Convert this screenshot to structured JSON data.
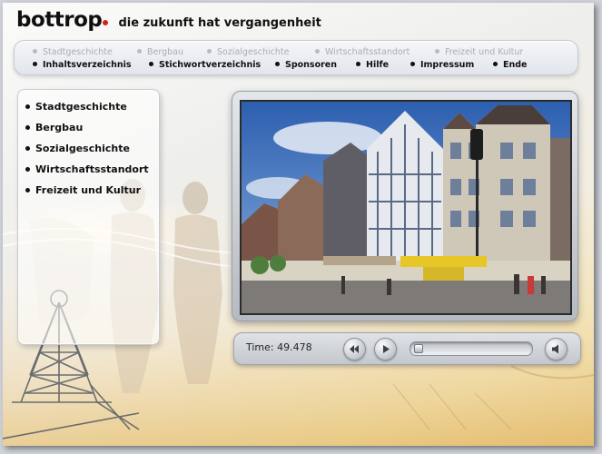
{
  "brand": {
    "name": "bottrop",
    "tagline": "die zukunft hat vergangenheit",
    "accent": "#d81e1e"
  },
  "topnav": {
    "chapters": [
      {
        "label": "Stadtgeschichte"
      },
      {
        "label": "Bergbau"
      },
      {
        "label": "Sozialgeschichte"
      },
      {
        "label": "Wirtschaftsstandort"
      },
      {
        "label": "Freizeit und Kultur"
      }
    ],
    "links": [
      {
        "label": "Inhaltsverzeichnis"
      },
      {
        "label": "Stichwortverzeichnis"
      },
      {
        "label": "Sponsoren"
      },
      {
        "label": "Hilfe"
      },
      {
        "label": "Impressum"
      },
      {
        "label": "Ende"
      }
    ]
  },
  "sidebar": {
    "items": [
      {
        "label": "Stadtgeschichte"
      },
      {
        "label": "Bergbau"
      },
      {
        "label": "Sozialgeschichte"
      },
      {
        "label": "Wirtschaftsstandort"
      },
      {
        "label": "Freizeit und Kultur"
      }
    ]
  },
  "player": {
    "time_label": "Time: 49.478",
    "position_fraction": 0.02,
    "buttons": {
      "rewind": {
        "icon": "rewind-icon"
      },
      "play": {
        "icon": "play-icon"
      },
      "volume": {
        "icon": "speaker-icon"
      }
    }
  }
}
